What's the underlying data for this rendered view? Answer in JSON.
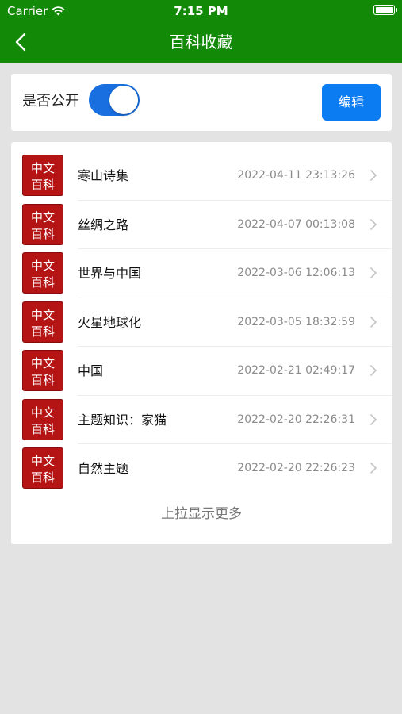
{
  "status_bar": {
    "carrier": "Carrier",
    "time": "7:15 PM"
  },
  "nav": {
    "title": "百科收藏"
  },
  "settings": {
    "public_label": "是否公开",
    "public_enabled": true,
    "edit_label": "编辑"
  },
  "favorites": [
    {
      "title": "寒山诗集",
      "date": "2022-04-11 23:13:26"
    },
    {
      "title": "丝绸之路",
      "date": "2022-04-07 00:13:08"
    },
    {
      "title": "世界与中国",
      "date": "2022-03-06 12:06:13"
    },
    {
      "title": "火星地球化",
      "date": "2022-03-05 18:32:59"
    },
    {
      "title": "中国",
      "date": "2022-02-21 02:49:17"
    },
    {
      "title": "主题知识：家猫",
      "date": "2022-02-20 22:26:31"
    },
    {
      "title": "自然主题",
      "date": "2022-02-20 22:26:23"
    }
  ],
  "logo": {
    "line1": "中文",
    "line2": "百科"
  },
  "load_more": "上拉显示更多",
  "colors": {
    "header": "#128a08",
    "accent": "#0b7cf2",
    "logo": "#b51414"
  }
}
